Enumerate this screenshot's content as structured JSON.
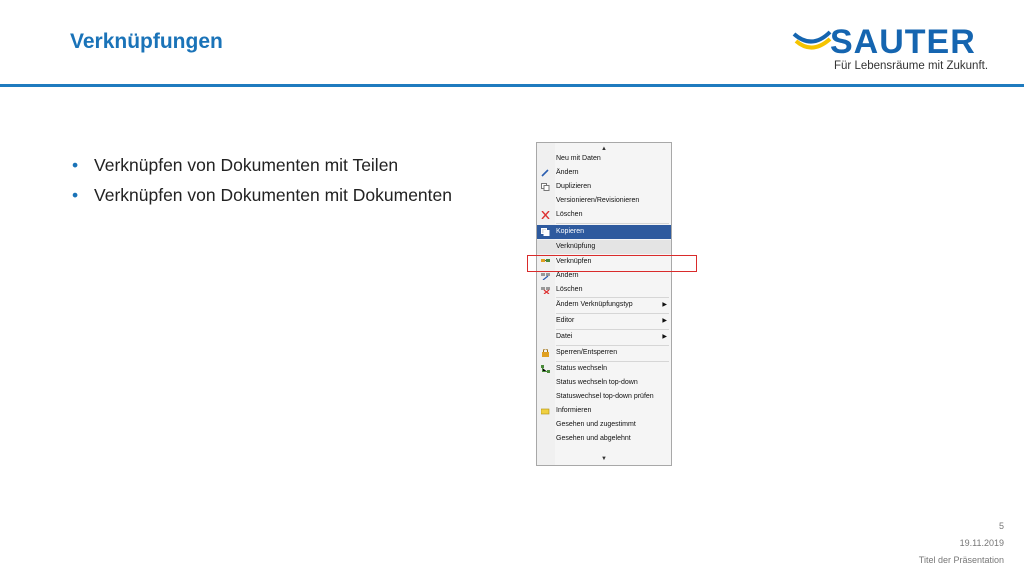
{
  "slide": {
    "title": "Verknüpfungen",
    "bullets": [
      "Verknüpfen von Dokumenten mit Teilen",
      "Verknüpfen von Dokumenten mit Dokumenten"
    ]
  },
  "logo": {
    "wordmark": "SAUTER",
    "tagline": "Für Lebensräume mit Zukunft.",
    "colors": {
      "primary": "#1565b0",
      "accent": "#f5c400"
    }
  },
  "context_menu": {
    "items": [
      {
        "label": "Neu mit Daten",
        "icon": "",
        "submenu": false
      },
      {
        "label": "Ändern",
        "icon": "pencil-icon",
        "submenu": false
      },
      {
        "label": "Duplizieren",
        "icon": "duplicate-icon",
        "submenu": false
      },
      {
        "label": "Versionieren/Revisionieren",
        "icon": "",
        "submenu": false
      },
      {
        "label": "Löschen",
        "icon": "delete-x-icon",
        "submenu": false
      },
      {
        "label": "Kopieren",
        "icon": "copy-icon",
        "submenu": false,
        "selected": true
      },
      {
        "label": "Verknüpfung",
        "icon": "",
        "submenu": false,
        "group_header": true
      },
      {
        "label": "Verknüpfen",
        "icon": "link-icon",
        "submenu": false,
        "highlighted": true
      },
      {
        "label": "Ändern",
        "icon": "link-edit-icon",
        "submenu": false
      },
      {
        "label": "Löschen",
        "icon": "link-delete-icon",
        "submenu": false
      },
      {
        "label": "Ändern Verknüpfungstyp",
        "icon": "",
        "submenu": true
      },
      {
        "label": "Editor",
        "icon": "",
        "submenu": true
      },
      {
        "label": "Datei",
        "icon": "",
        "submenu": true
      },
      {
        "label": "Sperren/Entsperren",
        "icon": "lock-icon",
        "submenu": false
      },
      {
        "label": "Status wechseln",
        "icon": "status-icon",
        "submenu": false
      },
      {
        "label": "Status wechseln top-down",
        "icon": "",
        "submenu": false
      },
      {
        "label": "Statuswechsel top-down prüfen",
        "icon": "",
        "submenu": false
      },
      {
        "label": "Informieren",
        "icon": "inform-icon",
        "submenu": false
      },
      {
        "label": "Gesehen und zugestimmt",
        "icon": "",
        "submenu": false
      },
      {
        "label": "Gesehen und abgelehnt",
        "icon": "",
        "submenu": false
      }
    ],
    "highlight_color": "#d92b2b",
    "selection_color": "#2e5a9e"
  },
  "footer": {
    "page_number": "5",
    "date": "19.11.2019",
    "presentation_title": "Titel der Präsentation"
  }
}
